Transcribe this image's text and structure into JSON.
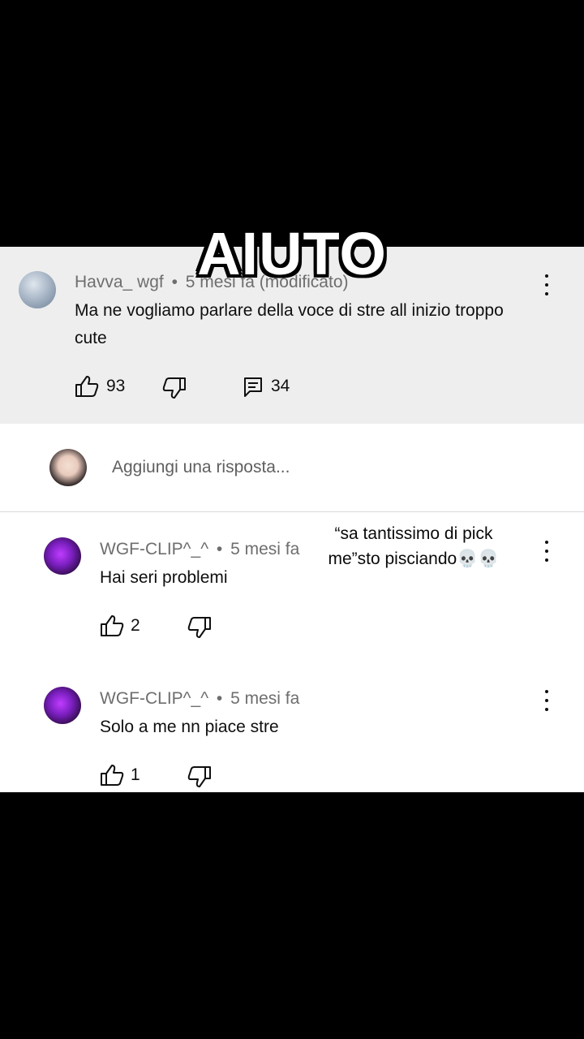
{
  "overlay": {
    "title": "AIUTO",
    "caption_line1": "“sa tantissimo di pick",
    "caption_line2": "me”sto pisciando💀💀"
  },
  "parent_comment": {
    "author": "Havva_ wgf",
    "separator": "•",
    "time": "5 mesi fa (modificato)",
    "text_line1": "Ma ne vogliamo parlare della voce di stre all inizio troppo",
    "text_line2": "cute",
    "likes": "93",
    "replies": "34",
    "avatar_icon": "sky-avatar"
  },
  "reply_box": {
    "placeholder": "Aggiungi una risposta...",
    "avatar_icon": "user-avatar"
  },
  "replies": [
    {
      "author": "WGF-CLIP^_^",
      "separator": "•",
      "time": "5 mesi fa",
      "text": "Hai seri problemi",
      "likes": "2"
    },
    {
      "author": "WGF-CLIP^_^",
      "separator": "•",
      "time": "5 mesi fa",
      "text": "Solo a me nn piace stre",
      "likes": "1"
    }
  ],
  "icons": [
    "thumb-up-icon",
    "thumb-down-icon",
    "reply-icon",
    "more-vertical-icon"
  ],
  "colors": {
    "parent_bg": "#eeeeee",
    "text": "#0f0f0f",
    "meta": "#6e6e6e",
    "letterbox": "#000000"
  }
}
